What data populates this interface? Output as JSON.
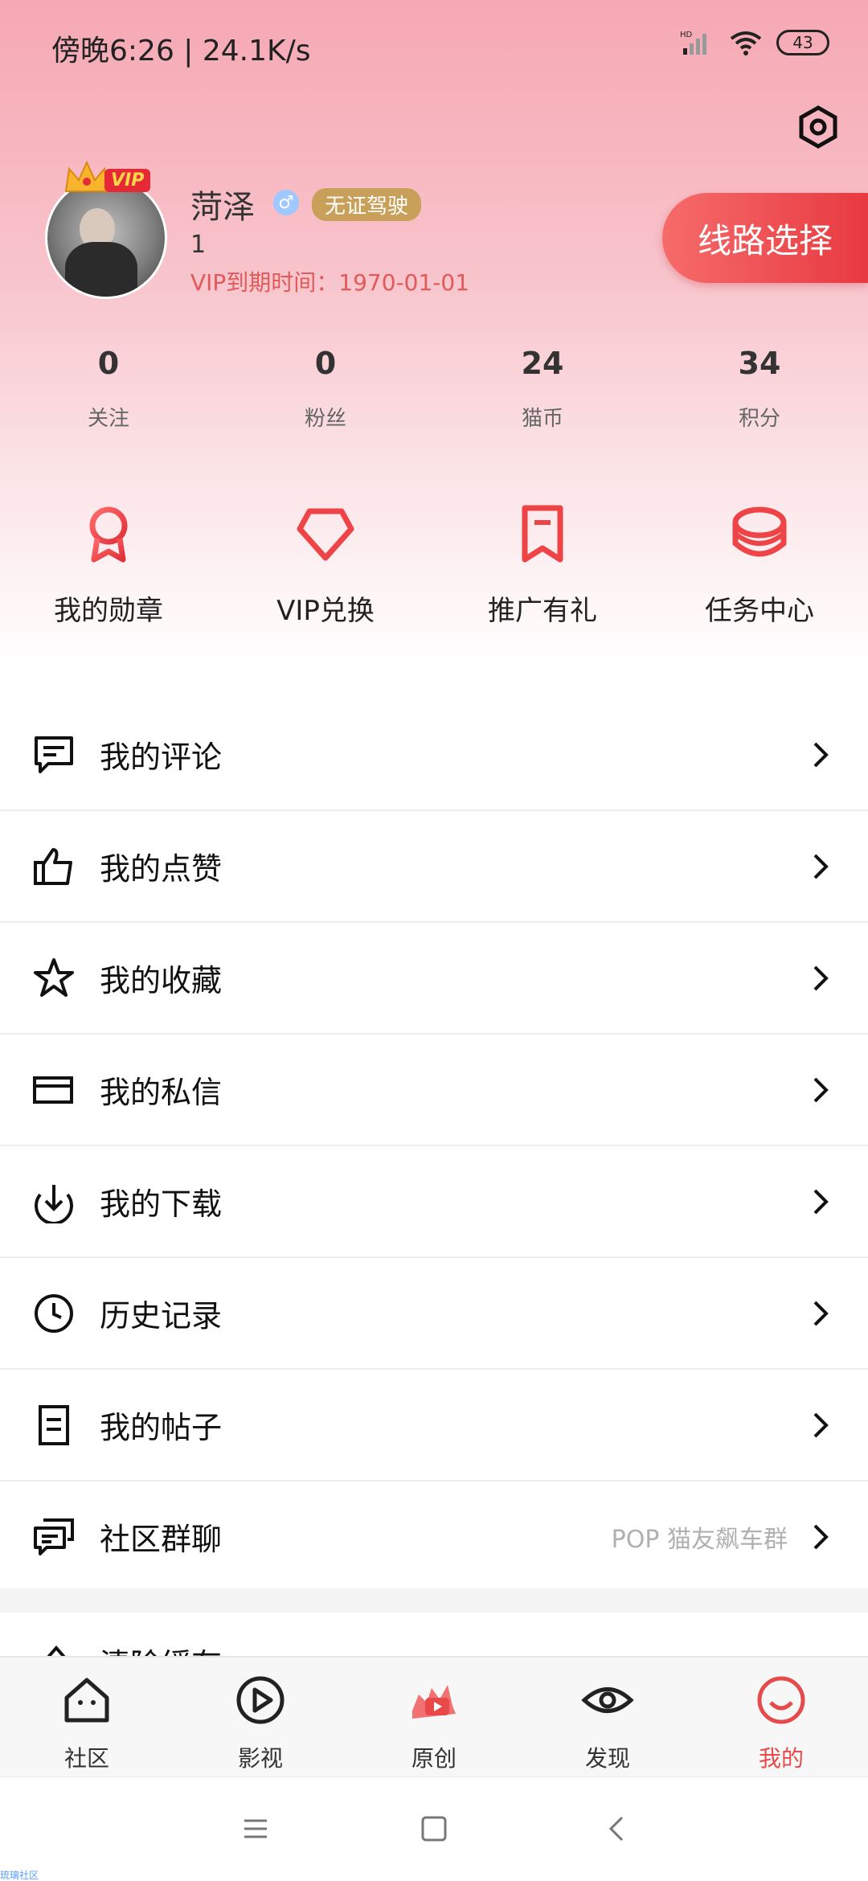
{
  "status_bar": {
    "time_speed": "傍晚6:26 | 24.1K/s",
    "battery": "43"
  },
  "profile": {
    "name": "菏泽",
    "gender_symbol": "♂",
    "badge": "无证驾驶",
    "uid": "1",
    "vip_expiry": "VIP到期时间：1970-01-01",
    "vip_tag": "VIP",
    "route_button": "线路选择"
  },
  "stats": [
    {
      "value": "0",
      "label": "关注"
    },
    {
      "value": "0",
      "label": "粉丝"
    },
    {
      "value": "24",
      "label": "猫币"
    },
    {
      "value": "34",
      "label": "积分"
    }
  ],
  "quick_actions": [
    {
      "label": "我的勋章",
      "icon": "medal-icon"
    },
    {
      "label": "VIP兑换",
      "icon": "diamond-icon"
    },
    {
      "label": "推广有礼",
      "icon": "bookmark-icon"
    },
    {
      "label": "任务中心",
      "icon": "coins-icon"
    }
  ],
  "menu": [
    {
      "label": "我的评论",
      "icon": "comment-icon",
      "hint": ""
    },
    {
      "label": "我的点赞",
      "icon": "thumbs-up-icon",
      "hint": ""
    },
    {
      "label": "我的收藏",
      "icon": "star-icon",
      "hint": ""
    },
    {
      "label": "我的私信",
      "icon": "mail-icon",
      "hint": ""
    },
    {
      "label": "我的下载",
      "icon": "download-icon",
      "hint": ""
    },
    {
      "label": "历史记录",
      "icon": "clock-icon",
      "hint": ""
    },
    {
      "label": "我的帖子",
      "icon": "document-icon",
      "hint": ""
    },
    {
      "label": "社区群聊",
      "icon": "chat-icon",
      "hint": "POP 猫友飙车群"
    }
  ],
  "partial_row": {
    "label": "清除缓存"
  },
  "bottom_nav": [
    {
      "label": "社区",
      "icon": "home-icon",
      "active": false
    },
    {
      "label": "影视",
      "icon": "play-icon",
      "active": false
    },
    {
      "label": "原创",
      "icon": "original-icon",
      "active": false
    },
    {
      "label": "发现",
      "icon": "eye-icon",
      "active": false
    },
    {
      "label": "我的",
      "icon": "smile-icon",
      "active": true
    }
  ],
  "watermark": "琉璃社区",
  "colors": {
    "accent": "#e54b4b",
    "hero_top": "#f6a8b3",
    "badge_gold": "#c9a05a"
  }
}
